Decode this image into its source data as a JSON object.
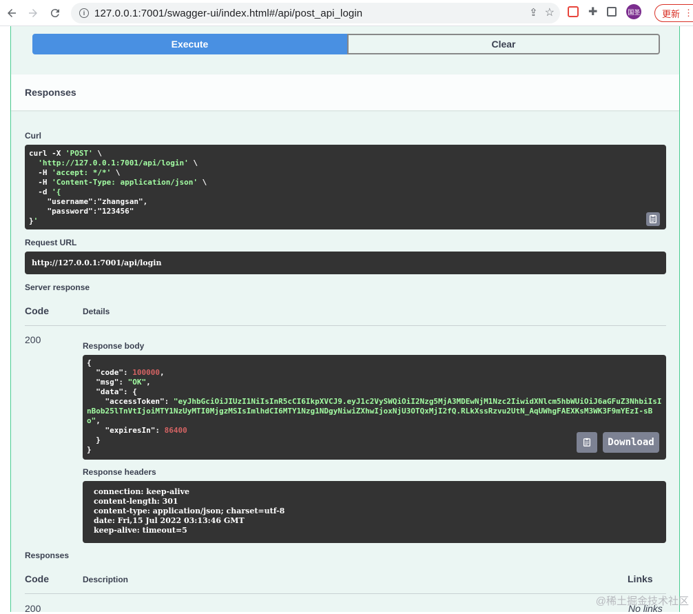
{
  "browser": {
    "url": "127.0.0.1:7001/swagger-ui/index.html#/api/post_api_login",
    "avatar_text": "国圣",
    "update_label": "更新"
  },
  "actions": {
    "execute_label": "Execute",
    "clear_label": "Clear"
  },
  "responses_title": "Responses",
  "curl": {
    "label": "Curl",
    "lines": [
      "curl -X 'POST' \\",
      "  'http://127.0.0.1:7001/api/login' \\",
      "  -H 'accept: */*' \\",
      "  -H 'Content-Type: application/json' \\",
      "  -d '{",
      "    \"username\":\"zhangsan\",",
      "    \"password\":\"123456\"",
      "}'"
    ]
  },
  "request_url": {
    "label": "Request URL",
    "value": "http://127.0.0.1:7001/api/login"
  },
  "server_response": {
    "label": "Server response",
    "code_header": "Code",
    "details_header": "Details",
    "code": "200",
    "body_label": "Response body",
    "body": {
      "code_key": "\"code\"",
      "code_val": "100000",
      "msg_key": "\"msg\"",
      "msg_val": "\"OK\"",
      "data_key": "\"data\"",
      "token_key": "\"accessToken\"",
      "token_line1": "\"eyJhbGciOiJIUzI1NiIsInR5cCI6IkpXVCJ9.eyJ1c2VySWQiOiI2Nzg5MjA3MDEwNjM1Nzc2IiwidXNlcm5hbWUiOiJ6aGFuZ3NhbiIsI",
      "token_line2": "nBob25lTnVtIjoiMTY1NzUyMTI0MjgzMSIsImlhdCI6MTY1Nzg1NDgyNiwiZXhwIjoxNjU3OTQxMjI2fQ.RLkXssRzvu2UtN_AqUWhgFAEXKsM3WK3F9mYEzI-sB",
      "token_line3": "o\"",
      "expires_key": "\"expiresIn\"",
      "expires_val": "86400"
    },
    "download_label": "Download",
    "headers_label": "Response headers",
    "headers": [
      "connection: keep-alive",
      "content-length: 301",
      "content-type: application/json; charset=utf-8",
      "date: Fri,15 Jul 2022 03:13:46 GMT",
      "keep-alive: timeout=5"
    ]
  },
  "responses_section": {
    "label": "Responses",
    "code_header": "Code",
    "description_header": "Description",
    "links_header": "Links",
    "first_code": "200",
    "first_links": "No links"
  },
  "watermark": "@稀土掘金技术社区"
}
